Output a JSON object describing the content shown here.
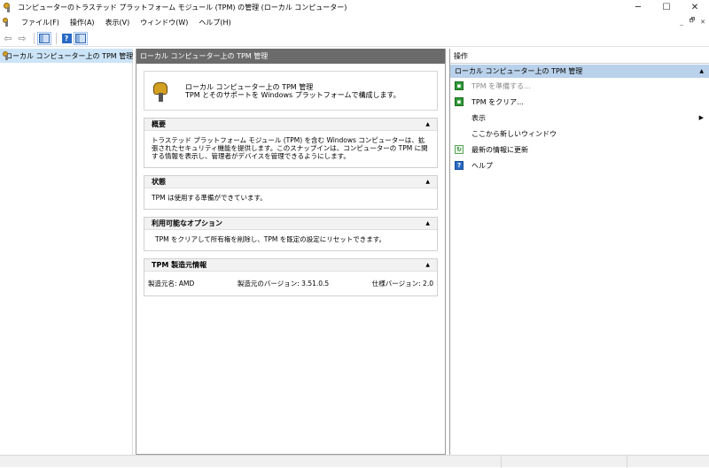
{
  "window": {
    "title": "コンピューターのトラステッド プラットフォーム モジュール (TPM) の管理 (ローカル コンピューター)",
    "minimize": "─",
    "maximize": "☐",
    "close": "✕"
  },
  "menubar": {
    "items": [
      "ファイル(F)",
      "操作(A)",
      "表示(V)",
      "ウィンドウ(W)",
      "ヘルプ(H)"
    ],
    "mdi_minimize": "_",
    "mdi_restore": "🗗",
    "mdi_close": "✕"
  },
  "toolbar": {
    "back": "⇦",
    "forward": "⇨",
    "help": "?"
  },
  "tree": {
    "root_label": "ローカル コンピューター上の TPM 管理"
  },
  "center": {
    "header": "ローカル コンピューター上の TPM 管理",
    "summary_line1": "ローカル コンピューター上の TPM 管理",
    "summary_line2": "TPM とそのサポートを Windows プラットフォームで構成します。",
    "sections": [
      {
        "title": "概要",
        "body": "トラステッド プラットフォーム モジュール (TPM) を含む Windows コンピューターは、拡張されたセキュリティ機能を提供します。このスナップインは、コンピューターの TPM に関する情報を表示し、管理者がデバイスを管理できるようにします。"
      },
      {
        "title": "状態",
        "body": "TPM は使用する準備ができています。"
      },
      {
        "title": "利用可能なオプション",
        "body": "TPM をクリアして所有権を削除し、TPM を既定の設定にリセットできます。"
      },
      {
        "title": "TPM 製造元情報",
        "manufacturer_name": "製造元名: AMD",
        "manufacturer_version": "製造元のバージョン: 3.51.0.5",
        "spec_version": "仕様バージョン: 2.0"
      }
    ]
  },
  "actions": {
    "header": "操作",
    "group_title": "ローカル コンピューター上の TPM 管理",
    "items": [
      {
        "label": "TPM を準備する...",
        "icon": "tpm-prepare-icon",
        "disabled": true
      },
      {
        "label": "TPM をクリア...",
        "icon": "tpm-clear-icon",
        "disabled": false
      },
      {
        "label": "表示",
        "icon": "",
        "disabled": false
      },
      {
        "label": "ここから新しいウィンドウ",
        "icon": "",
        "disabled": false
      },
      {
        "label": "最新の情報に更新",
        "icon": "refresh-icon",
        "disabled": false
      },
      {
        "label": "ヘルプ",
        "icon": "help-icon",
        "disabled": false
      }
    ]
  },
  "colors": {
    "header_bg": "#6b6b6b",
    "selection_bg": "#cce4f7",
    "action_group_bg": "#b9d1ea",
    "action_icon_green": "#2e9a35",
    "help_icon_blue": "#2a6ac6"
  }
}
